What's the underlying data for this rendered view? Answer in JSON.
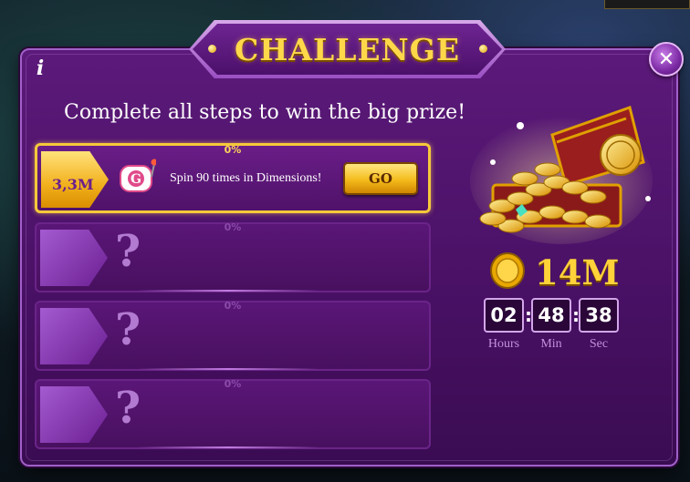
{
  "header": {
    "title": "CHALLENGE"
  },
  "controls": {
    "close_symbol": "✕",
    "info_symbol": "i"
  },
  "subtitle": "Complete all steps to win the big prize!",
  "steps": [
    {
      "progress": "0%",
      "reward": "3,3M",
      "task": "Spin 90 times in Dimensions!",
      "button": "GO",
      "locked": false
    },
    {
      "progress": "0%",
      "locked_symbol": "?",
      "locked": true
    },
    {
      "progress": "0%",
      "locked_symbol": "?",
      "locked": true
    },
    {
      "progress": "0%",
      "locked_symbol": "?",
      "locked": true
    }
  ],
  "prize": {
    "amount": "14M",
    "icon": "gold-coin-icon"
  },
  "timer": {
    "hours": "02",
    "minutes": "48",
    "seconds": "38",
    "separator": ":",
    "hours_label": "Hours",
    "minutes_label": "Min",
    "seconds_label": "Sec"
  },
  "colors": {
    "accent_gold": "#ffd23a",
    "panel_purple": "#4a1166",
    "button_gold": "#f4bb1c"
  }
}
